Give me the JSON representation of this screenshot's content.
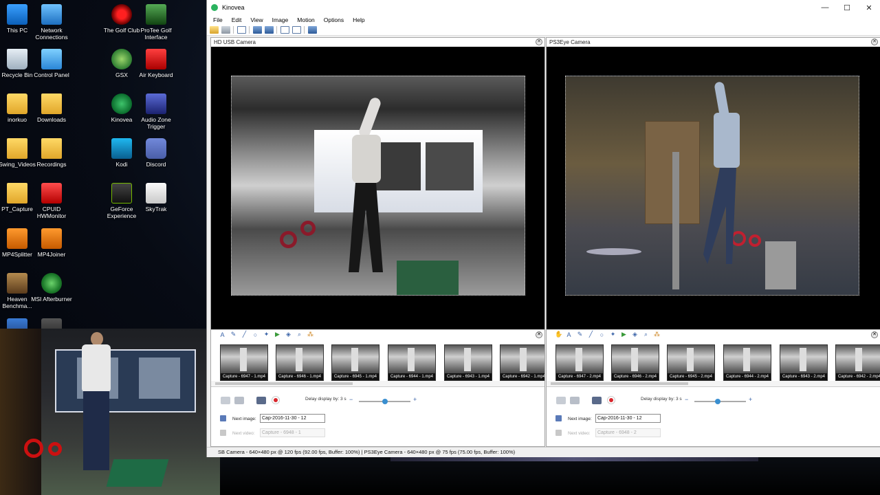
{
  "desktop": {
    "icons": [
      {
        "label": "This PC",
        "icon": "computer-icon"
      },
      {
        "label": "Network Connections",
        "icon": "network-icon"
      },
      {
        "label": "Recycle Bin",
        "icon": "recycle-bin-icon"
      },
      {
        "label": "Control Panel",
        "icon": "control-panel-icon"
      },
      {
        "label": "inorkuo",
        "icon": "user-folder-icon"
      },
      {
        "label": "Downloads",
        "icon": "folder-icon"
      },
      {
        "label": "Swing_Videos",
        "icon": "folder-icon"
      },
      {
        "label": "Recordings",
        "icon": "folder-icon"
      },
      {
        "label": "PT_Capture",
        "icon": "folder-icon"
      },
      {
        "label": "CPUID HWMonitor",
        "icon": "hwmonitor-icon"
      },
      {
        "label": "MP4Splitter",
        "icon": "mp4splitter-icon"
      },
      {
        "label": "MP4Joiner",
        "icon": "mp4joiner-icon"
      },
      {
        "label": "Heaven Benchma...",
        "icon": "heaven-icon"
      },
      {
        "label": "MSI Afterburner",
        "icon": "afterburner-icon"
      },
      {
        "label": "The Golf Club",
        "icon": "golf-club-icon"
      },
      {
        "label": "ProTee Golf Interface",
        "icon": "protee-icon"
      },
      {
        "label": "GSX",
        "icon": "gsx-icon"
      },
      {
        "label": "Air Keyboard",
        "icon": "air-keyboard-icon"
      },
      {
        "label": "Kinovea",
        "icon": "kinovea-icon"
      },
      {
        "label": "Audio Zone Trigger",
        "icon": "audio-zone-icon"
      },
      {
        "label": "Kodi",
        "icon": "kodi-icon"
      },
      {
        "label": "Discord",
        "icon": "discord-icon"
      },
      {
        "label": "GeForce Experience",
        "icon": "geforce-icon"
      },
      {
        "label": "SkyTrak",
        "icon": "skytrak-icon"
      }
    ]
  },
  "window": {
    "title": "Kinovea",
    "minimize": "—",
    "maximize": "☐",
    "close": "✕"
  },
  "menu": [
    "File",
    "Edit",
    "View",
    "Image",
    "Motion",
    "Options",
    "Help"
  ],
  "screens": [
    {
      "camera_name": "HD USB Camera",
      "thumbnails": [
        "Capture - 6947 - 1.mp4",
        "Capture - 6946 - 1.mp4",
        "Capture - 6945 - 1.mp4",
        "Capture - 6944 - 1.mp4",
        "Capture - 6943 - 1.mp4",
        "Capture - 6942 - 1.mp4"
      ],
      "delay_label": "Delay display by: 3 s",
      "delay_fraction": 0.5,
      "next_image_label": "Next image:",
      "next_image_value": "Cap-2016-11-30 - 12",
      "next_video_label": "Next video:",
      "next_video_value": "Capture - 6948 - 1"
    },
    {
      "camera_name": "PS3Eye Camera",
      "thumbnails": [
        "Capture - 6947 - 2.mp4",
        "Capture - 6946 - 2.mp4",
        "Capture - 6945 - 2.mp4",
        "Capture - 6944 - 2.mp4",
        "Capture - 6943 - 2.mp4",
        "Capture - 6942 - 2.mp4"
      ],
      "delay_label": "Delay display by: 3 s",
      "delay_fraction": 0.45,
      "next_image_label": "Next image:",
      "next_image_value": "Cap-2016-11-30 - 12",
      "next_video_label": "Next video:",
      "next_video_value": "Capture - 6948 - 2"
    }
  ],
  "status_bar": "SB Camera - 640×480 px @ 120 fps (92.00 fps, Buffer: 100%) | PS3Eye Camera - 640×480 px @ 75 fps (75.00 fps, Buffer: 100%)",
  "colors": {
    "accent": "#3a8fd0",
    "record": "#d9262c",
    "tool_blue": "#3b64a8"
  }
}
